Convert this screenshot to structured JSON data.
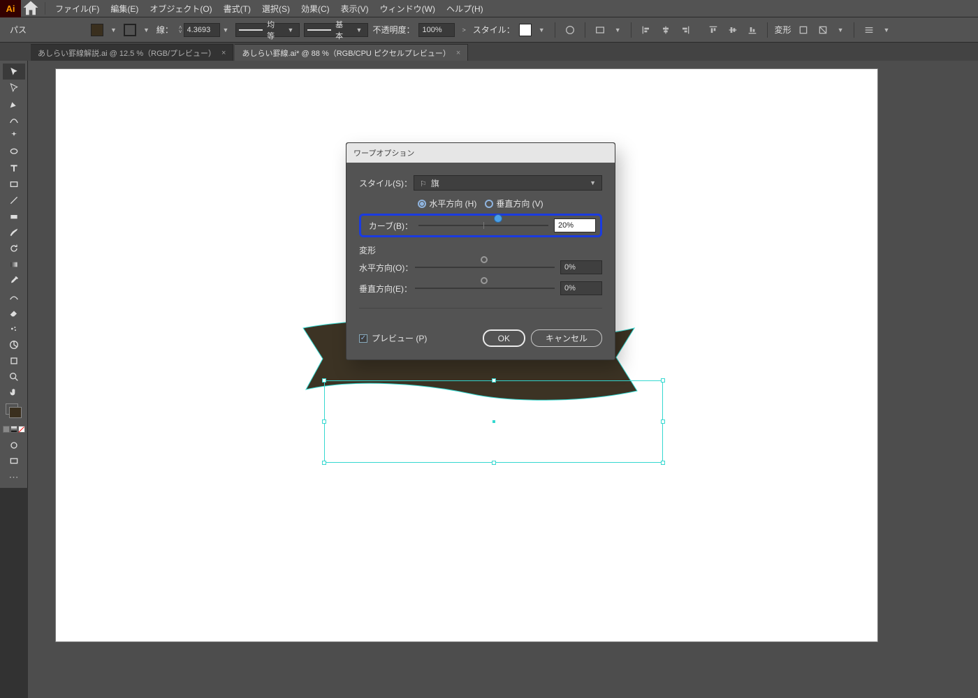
{
  "menubar": {
    "items": [
      "ファイル(F)",
      "編集(E)",
      "オブジェクト(O)",
      "書式(T)",
      "選択(S)",
      "効果(C)",
      "表示(V)",
      "ウィンドウ(W)",
      "ヘルプ(H)"
    ]
  },
  "controlbar": {
    "mode_label": "パス",
    "stroke_label": "線：",
    "stroke_weight": "4.3693",
    "profile1": "均等",
    "profile2": "基本",
    "opacity_label": "不透明度：",
    "opacity_value": "100%",
    "style_label": "スタイル：",
    "transform_label": "変形"
  },
  "tabs": [
    {
      "label": "あしらい罫線解説.ai @ 12.5 %（RGB/プレビュー）",
      "active": false
    },
    {
      "label": "あしらい罫線.ai* @ 88 %（RGB/CPU ピクセルプレビュー）",
      "active": true
    }
  ],
  "dialog": {
    "title": "ワープオプション",
    "style_label": "スタイル(S)：",
    "style_value": "旗",
    "radio_h": "水平方向 (H)",
    "radio_v": "垂直方向 (V)",
    "bend_label": "カーブ(B)：",
    "bend_value": "20%",
    "distort_label": "変形",
    "horiz_label": "水平方向(O)：",
    "horiz_value": "0%",
    "vert_label": "垂直方向(E)：",
    "vert_value": "0%",
    "preview_label": "プレビュー (P)",
    "ok": "OK",
    "cancel": "キャンセル"
  },
  "colors": {
    "ribbon_fill": "#3c3324"
  }
}
